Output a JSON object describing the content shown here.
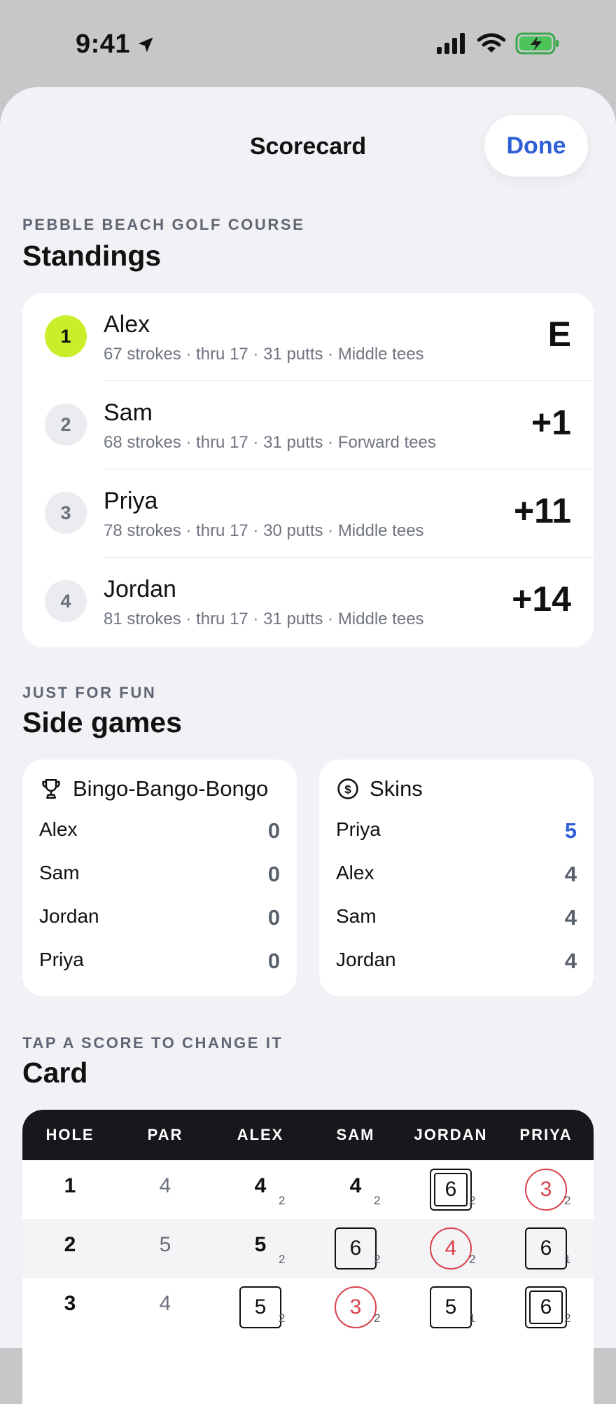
{
  "status_bar": {
    "time": "9:41"
  },
  "nav": {
    "title": "Scorecard",
    "done_label": "Done"
  },
  "standings": {
    "eyebrow": "PEBBLE BEACH GOLF COURSE",
    "title": "Standings",
    "players": [
      {
        "rank": "1",
        "name": "Alex",
        "meta": "67 strokes · thru 17 · 31 putts · Middle tees",
        "score": "E"
      },
      {
        "rank": "2",
        "name": "Sam",
        "meta": "68 strokes · thru 17 · 31 putts · Forward tees",
        "score": "+1"
      },
      {
        "rank": "3",
        "name": "Priya",
        "meta": "78 strokes · thru 17 · 30 putts · Middle tees",
        "score": "+11"
      },
      {
        "rank": "4",
        "name": "Jordan",
        "meta": "81 strokes · thru 17 · 31 putts · Middle tees",
        "score": "+14"
      }
    ]
  },
  "side_games": {
    "eyebrow": "JUST FOR FUN",
    "title": "Side games",
    "games": [
      {
        "title": "Bingo-Bango-Bongo",
        "icon": "trophy-icon",
        "rows": [
          {
            "player": "Alex",
            "value": "0"
          },
          {
            "player": "Sam",
            "value": "0"
          },
          {
            "player": "Jordan",
            "value": "0"
          },
          {
            "player": "Priya",
            "value": "0"
          }
        ]
      },
      {
        "title": "Skins",
        "icon": "dollar-coin-icon",
        "rows": [
          {
            "player": "Priya",
            "value": "5"
          },
          {
            "player": "Alex",
            "value": "4"
          },
          {
            "player": "Sam",
            "value": "4"
          },
          {
            "player": "Jordan",
            "value": "4"
          }
        ]
      }
    ]
  },
  "card": {
    "eyebrow": "TAP A SCORE TO CHANGE IT",
    "title": "Card",
    "headers": [
      "HOLE",
      "PAR",
      "ALEX",
      "SAM",
      "JORDAN",
      "PRIYA"
    ],
    "rows": [
      {
        "hole": "1",
        "par": "4",
        "scores": [
          {
            "score": "4",
            "putts": "2",
            "type": "par"
          },
          {
            "score": "4",
            "putts": "2",
            "type": "par"
          },
          {
            "score": "6",
            "putts": "2",
            "type": "double"
          },
          {
            "score": "3",
            "putts": "2",
            "type": "birdie"
          }
        ]
      },
      {
        "hole": "2",
        "par": "5",
        "scores": [
          {
            "score": "5",
            "putts": "2",
            "type": "par"
          },
          {
            "score": "6",
            "putts": "2",
            "type": "bogey"
          },
          {
            "score": "4",
            "putts": "2",
            "type": "birdie"
          },
          {
            "score": "6",
            "putts": "1",
            "type": "bogey"
          }
        ]
      },
      {
        "hole": "3",
        "par": "4",
        "scores": [
          {
            "score": "5",
            "putts": "2",
            "type": "bogey"
          },
          {
            "score": "3",
            "putts": "2",
            "type": "birdie"
          },
          {
            "score": "5",
            "putts": "1",
            "type": "bogey"
          },
          {
            "score": "6",
            "putts": "2",
            "type": "double"
          }
        ]
      }
    ]
  },
  "colors": {
    "accent": "#2f5fd6",
    "leader": "#c8ef2a",
    "birdie": "#d9404a",
    "header_bg": "#16181c"
  }
}
